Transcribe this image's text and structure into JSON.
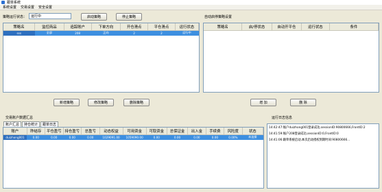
{
  "window": {
    "title": "跟单系统"
  },
  "menu": [
    "系统设置",
    "交易设置",
    "安全设置"
  ],
  "top": {
    "status_label": "策略运行状态：",
    "status_value": "运行中",
    "start_button": "启动策略",
    "stop_button": "停止策略",
    "auto_settings_label": "自动启停策略设置"
  },
  "strategy_grid": {
    "columns": [
      "策略名",
      "监控商品",
      "追踪账户",
      "下单方向",
      "开仓滑点",
      "平仓滑点",
      "运行状态"
    ],
    "rows": [
      [
        "sss",
        "全部",
        "208",
        "正向",
        "2",
        "2",
        "运行中"
      ]
    ]
  },
  "auto_grid": {
    "columns": [
      "策略名",
      "启/停状态",
      "自动开平仓",
      "运行状态",
      "条件"
    ]
  },
  "buttons": {
    "new": "新增策略",
    "modify": "修改策略",
    "delete": "删除策略",
    "add": "增 加",
    "remove": "删 除"
  },
  "account_section": {
    "label": "交易账户数据汇总",
    "tabs": [
      "账户汇总",
      "持仓统计",
      "跟单日志"
    ],
    "columns": [
      "账户",
      "昨结存",
      "平仓盈亏",
      "持仓盈亏",
      "总盈亏",
      "动态权益",
      "可用资金",
      "可取资金",
      "总保证金",
      "出入金",
      "手续费",
      "风险度",
      "状态"
    ],
    "rows": [
      [
        "duizhong001",
        "0.00",
        "0.00",
        "0.00",
        "0.00",
        "1029091.00",
        "1059090.00",
        "0.00",
        "0.00",
        "0.00",
        "0.00",
        "0.00%",
        "未连接"
      ]
    ]
  },
  "log_section": {
    "label": "运行日志信息",
    "lines": [
      "14:42:47:账户duizhong001登录成功,sessionID:90800666,FrontID:2",
      "14:41:59:账户208登录成功,sessionID:0,FrontID:0",
      "14:41:06:跟单系统启动,本次启动授权到期时间:90800666..."
    ]
  },
  "colors": {
    "background": "#ece9d8",
    "selection": "#3d8fe0",
    "header": "#ebeadb"
  }
}
